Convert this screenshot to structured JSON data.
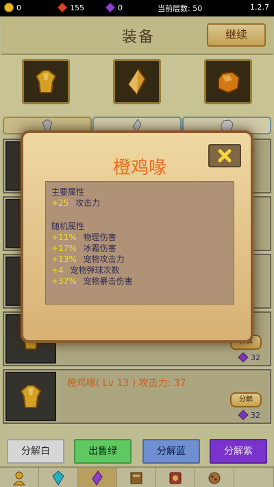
{
  "status": {
    "gold": "0",
    "ruby": "155",
    "gems": "0",
    "floor_label": "当前层数: 50",
    "version": "1.2.7"
  },
  "header": {
    "title": "装备",
    "continue_label": "继续",
    "equipped_tag": "装备"
  },
  "equipment_slots": [
    {
      "icon": "gold-armor-icon"
    },
    {
      "icon": "orange-crystal-icon"
    },
    {
      "icon": "orange-ore-icon"
    }
  ],
  "tabs": [
    {
      "icon": "silver-armor-icon",
      "active": true
    },
    {
      "icon": "silver-crystal-icon",
      "active": false
    },
    {
      "icon": "silver-ore-icon",
      "active": false
    }
  ],
  "rows": [
    {
      "dismantle": "分解",
      "price": "32"
    },
    {
      "name": "橙鸡喙( Lv 13 ) 攻击力:  37",
      "dismantle": "分解",
      "price": "32"
    }
  ],
  "popup": {
    "title": "橙鸡喙",
    "main_attr_title": "主要属性",
    "main_attr_value": "+25",
    "main_attr_name": "攻击力",
    "random_title": "随机属性",
    "random_attrs": [
      {
        "value": "+11%",
        "name": "物理伤害"
      },
      {
        "value": "+17%",
        "name": "冰霜伤害"
      },
      {
        "value": "+13%",
        "name": "宠物攻击力"
      },
      {
        "value": "+4",
        "name": "宠物弹球次数"
      },
      {
        "value": "+37%",
        "name": "宠物暴击伤害"
      }
    ]
  },
  "bottom_buttons": [
    {
      "label": "分解白",
      "color": "#f4f4f4",
      "text": "#333333"
    },
    {
      "label": "出售绿",
      "color": "#6be56f",
      "text": "#0c2c0c"
    },
    {
      "label": "分解蓝",
      "color": "#7fa3ee",
      "text": "#0f1d4d"
    },
    {
      "label": "分解紫",
      "color": "#8b39ea",
      "text": "#ffffff"
    }
  ],
  "nav": [
    "character-icon",
    "gem-icon",
    "purple-crystal-icon",
    "book-icon",
    "map-icon",
    "cookie-icon"
  ]
}
